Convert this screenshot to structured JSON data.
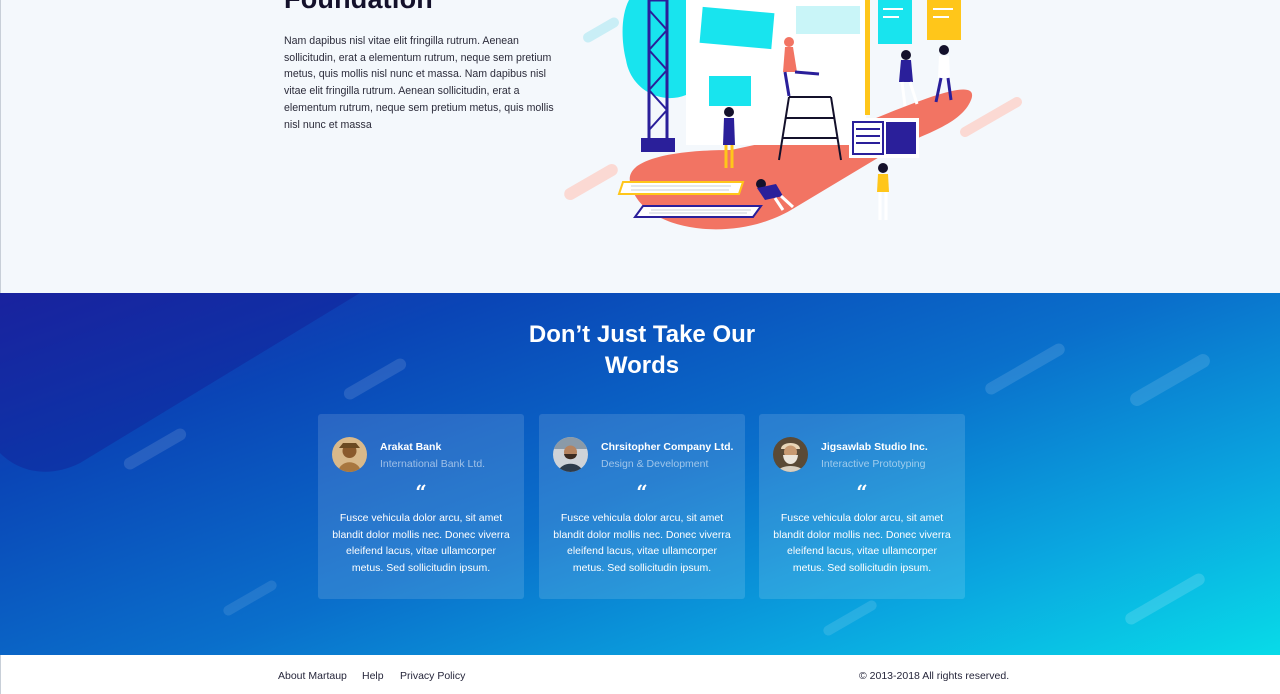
{
  "hero": {
    "title": "Foundation",
    "paragraph": "Nam dapibus nisl vitae elit fringilla rutrum. Aenean sollicitudin, erat a elementum rutrum, neque sem pretium metus, quis mollis nisl nunc et massa. Nam dapibus nisl vitae elit fringilla rutrum. Aenean sollicitudin, erat a elementum rutrum, neque sem pretium metus, quis mollis nisl nunc et massa"
  },
  "testimonials": {
    "title": "Don’t Just Take Our Words",
    "quote_mark": "“",
    "cards": [
      {
        "company": "Arakat Bank",
        "role": "International Bank Ltd.",
        "quote": "Fusce vehicula dolor arcu, sit amet blandit dolor mollis nec. Donec viverra eleifend lacus, vitae ullamcorper metus. Sed sollicitudin ipsum.",
        "avatar": "avatar-person-hat"
      },
      {
        "company": "Chrsitopher Company Ltd.",
        "role": "Design & Development",
        "quote": "Fusce vehicula dolor arcu, sit amet blandit dolor mollis nec. Donec viverra eleifend lacus, vitae ullamcorper metus. Sed sollicitudin ipsum.",
        "avatar": "avatar-person-beard"
      },
      {
        "company": "Jigsawlab Studio Inc.",
        "role": "Interactive Prototyping",
        "quote": "Fusce vehicula dolor arcu, sit amet blandit dolor mollis nec. Donec viverra eleifend lacus, vitae ullamcorper metus. Sed sollicitudin ipsum.",
        "avatar": "avatar-elder-man"
      }
    ]
  },
  "footer": {
    "links": [
      "About Martaup",
      "Help",
      "Privacy Policy"
    ],
    "copyright": "© 2013-2018 All rights reserved."
  },
  "colors": {
    "accent_coral": "#f27463",
    "accent_cyan": "#18e4ee",
    "accent_navy": "#2a1f9a",
    "accent_yellow": "#ffc61a",
    "gradient_start": "#1d2aa8",
    "gradient_end": "#08dbe8"
  }
}
